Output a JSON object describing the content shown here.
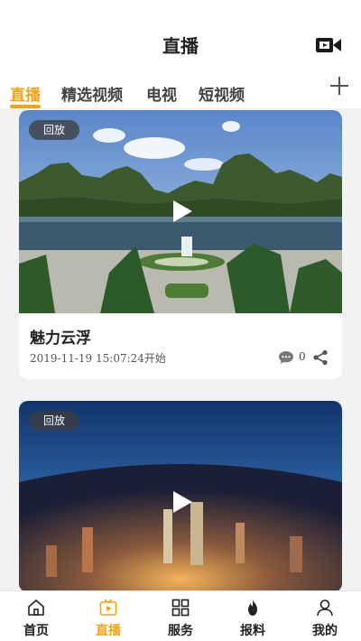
{
  "header": {
    "title": "直播",
    "camera_icon": "video-camera-icon"
  },
  "tabs": [
    {
      "label": "直播",
      "active": true
    },
    {
      "label": "精选视频",
      "active": false
    },
    {
      "label": "电视",
      "active": false
    },
    {
      "label": "短视频",
      "active": false
    }
  ],
  "tabs_more_icon": "plus-icon",
  "accent": "#f2a318",
  "cards": [
    {
      "badge": "回放",
      "title": "魅力云浮",
      "time": "2019-11-19 15:07:24开始",
      "comments": "0"
    },
    {
      "badge": "回放"
    }
  ],
  "bottom_nav": [
    {
      "label": "首页",
      "icon": "home-icon",
      "active": false
    },
    {
      "label": "直播",
      "icon": "tv-icon",
      "active": true
    },
    {
      "label": "服务",
      "icon": "grid-icon",
      "active": false
    },
    {
      "label": "报料",
      "icon": "fire-icon",
      "active": false
    },
    {
      "label": "我的",
      "icon": "user-icon",
      "active": false
    }
  ]
}
